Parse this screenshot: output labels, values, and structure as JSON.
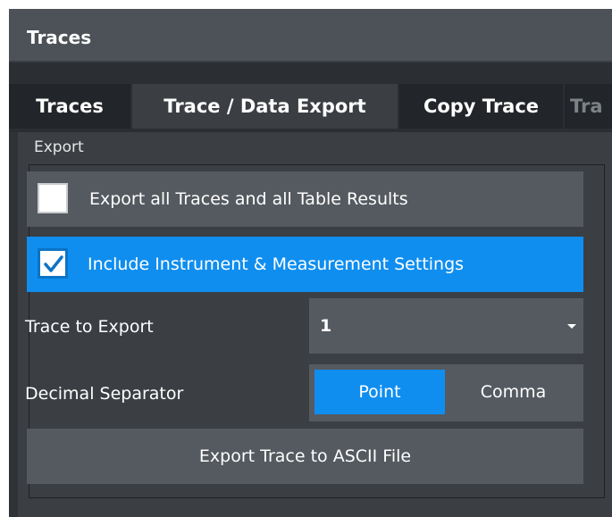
{
  "window": {
    "title": "Traces"
  },
  "tabs": [
    {
      "label": "Traces",
      "active": false
    },
    {
      "label": "Trace / Data Export",
      "active": true
    },
    {
      "label": "Copy Trace",
      "active": false
    },
    {
      "label": "Tra",
      "active": false,
      "truncated": true
    }
  ],
  "export_group": {
    "label": "Export",
    "export_all": {
      "label": "Export all Traces and all Table Results",
      "checked": false
    },
    "include_settings": {
      "label": "Include Instrument & Measurement Settings",
      "checked": true
    },
    "trace_to_export": {
      "label": "Trace to Export",
      "value": "1"
    },
    "decimal_separator": {
      "label": "Decimal Separator",
      "options": [
        "Point",
        "Comma"
      ],
      "selected": "Point"
    },
    "export_button_label": "Export Trace to ASCII File"
  },
  "colors": {
    "accent": "#0f8ef0",
    "panel": "#3b3f44",
    "control": "#555a60",
    "title_bar": "#4d5258"
  }
}
